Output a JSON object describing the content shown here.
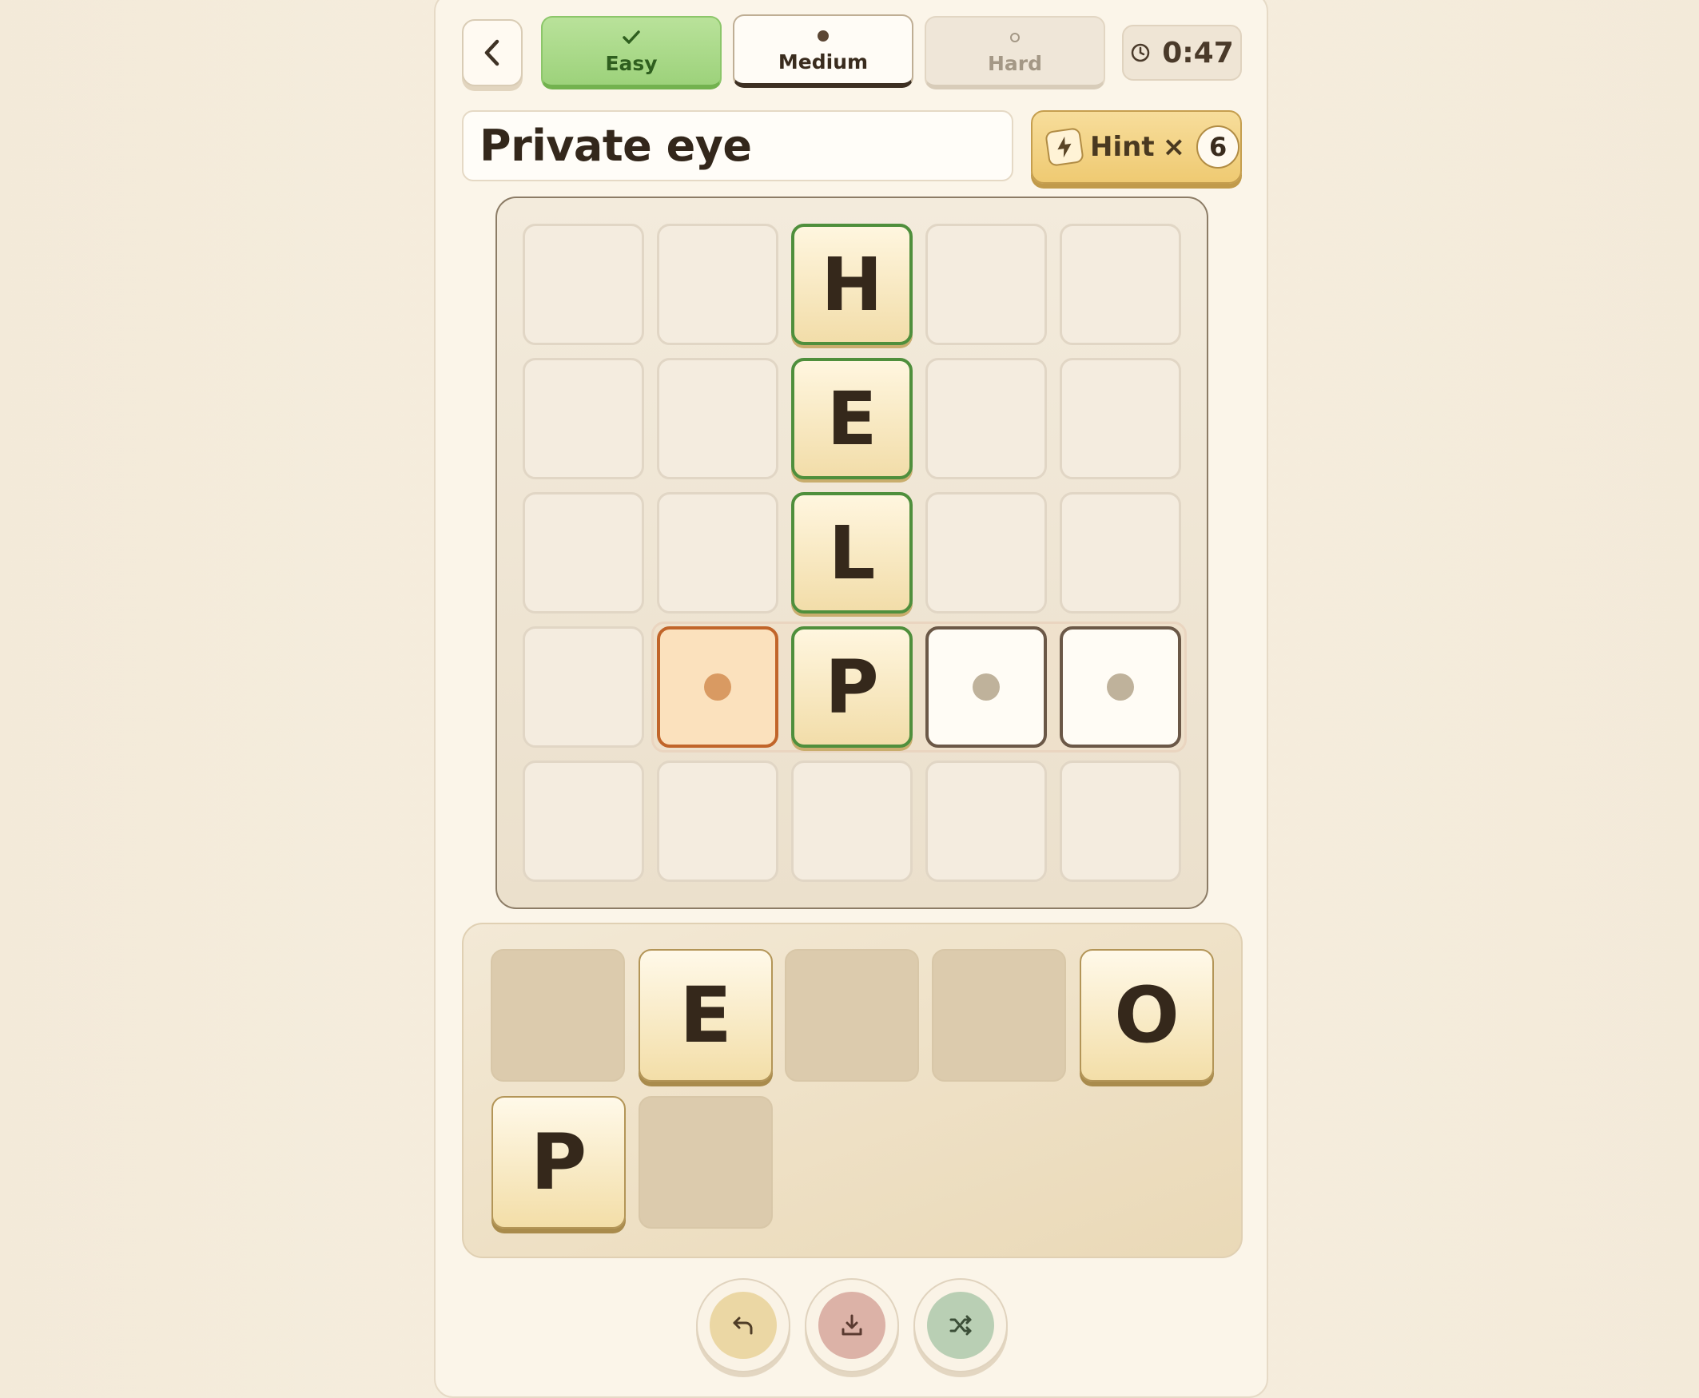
{
  "header": {
    "back_icon": "chevron-left-icon",
    "difficulties": [
      {
        "label": "Easy",
        "state": "completed",
        "icon": "check-icon"
      },
      {
        "label": "Medium",
        "state": "selected",
        "icon": "dot-filled-icon"
      },
      {
        "label": "Hard",
        "state": "locked",
        "icon": "dot-ring-icon"
      }
    ],
    "timer": "0:47"
  },
  "clue": "Private eye",
  "hint": {
    "label": "Hint",
    "times": "×",
    "count": "6"
  },
  "board": {
    "rows": [
      [
        "",
        "",
        "H",
        "",
        ""
      ],
      [
        "",
        "",
        "E",
        "",
        ""
      ],
      [
        "",
        "",
        "L",
        "",
        ""
      ],
      [
        "",
        "",
        "P",
        "",
        ""
      ],
      [
        "",
        "",
        "",
        "",
        ""
      ]
    ]
  },
  "tray": {
    "tiles": [
      "",
      "E",
      "",
      "",
      "O",
      "P",
      ""
    ]
  },
  "actions": [
    {
      "name": "undo-button",
      "icon": "undo-icon",
      "color": "#ebd7a4"
    },
    {
      "name": "download-button",
      "icon": "download-icon",
      "color": "#dcb2a7"
    },
    {
      "name": "shuffle-button",
      "icon": "shuffle-icon",
      "color": "#b9cfb4"
    }
  ],
  "colors": {
    "correct": "#4f8f3c",
    "active": "#c1652a",
    "accent": "#efca72"
  }
}
